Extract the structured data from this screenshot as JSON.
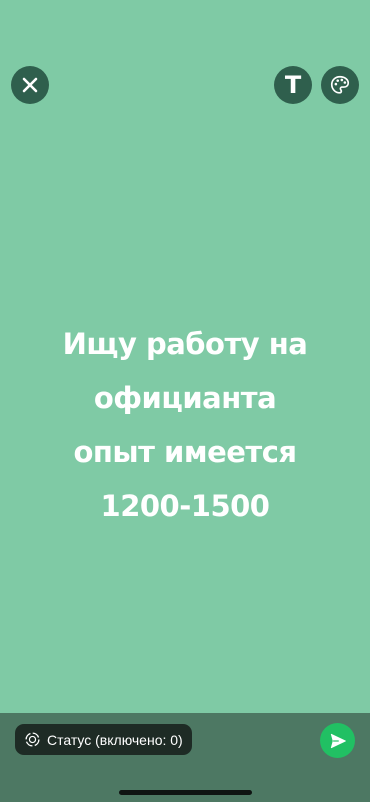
{
  "toolbar": {
    "close_icon": "close-icon",
    "text_tool_label": "T",
    "palette_icon": "palette-icon"
  },
  "status": {
    "lines": [
      "Ищу работу на",
      "официанта",
      "опыт имеется",
      "1200-1500"
    ],
    "background_color": "#7fcaa5",
    "text_color": "#ffffff"
  },
  "footer": {
    "audience_label": "Статус (включено: 0)",
    "audience_icon": "status-ring-icon",
    "send_icon": "send-icon",
    "send_color": "#21c063"
  }
}
